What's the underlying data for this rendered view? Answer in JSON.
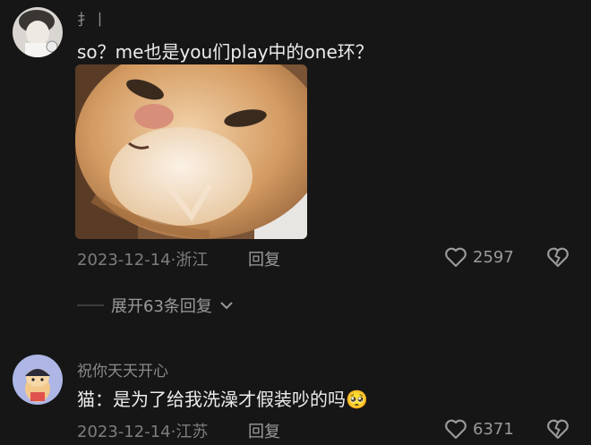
{
  "comment1": {
    "username": "扌丨",
    "text": "so？me也是you们play中的one环？",
    "date": "2023-12-14·浙江",
    "reply_label": "回复",
    "likes": "2597",
    "expand_label": "展开63条回复"
  },
  "comment2": {
    "username": "祝你天天开心",
    "text": "猫：是为了给我洗澡才假装吵的吗",
    "emoji": "🥺",
    "date": "2023-12-14·江苏",
    "reply_label": "回复",
    "likes": "6371"
  },
  "colors": {
    "background": "#161616",
    "text": "#ececec",
    "muted": "#7d7d7d",
    "avatar2_bg": "#aeb6e6"
  },
  "icons": [
    "heart-outline-icon",
    "broken-heart-icon",
    "chevron-down-icon",
    "cat-photo"
  ]
}
